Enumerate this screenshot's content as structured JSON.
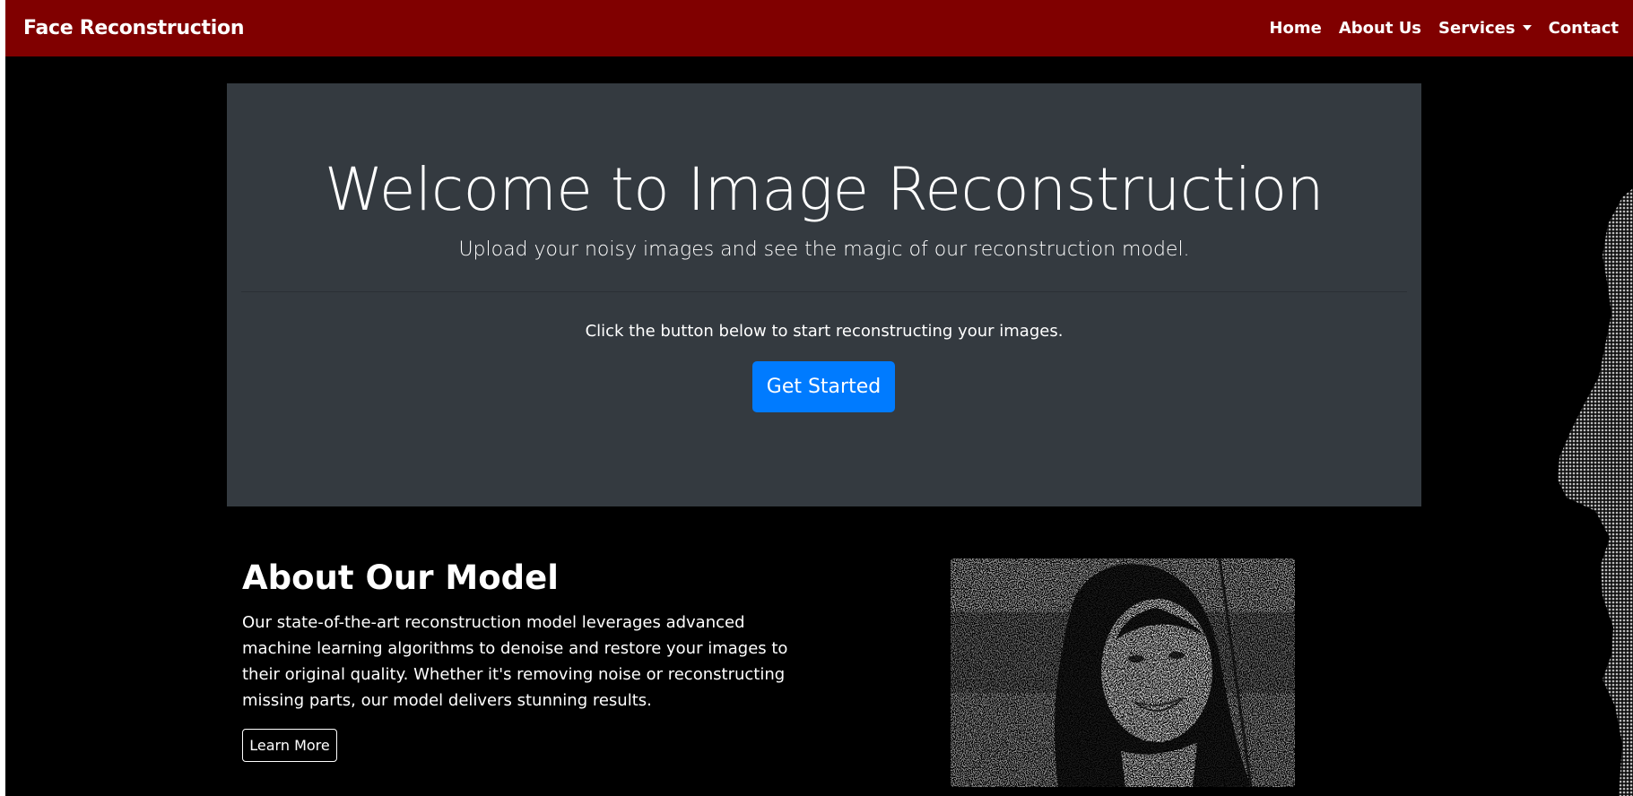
{
  "navbar": {
    "brand": "Face Reconstruction",
    "links": [
      "Home",
      "About Us",
      "Services",
      "Contact"
    ],
    "bg_color": "#800000"
  },
  "hero": {
    "title": "Welcome to Image Reconstruction",
    "subtitle": "Upload your noisy images and see the magic of our reconstruction model.",
    "cta_text": "Click the button below to start reconstructing your images.",
    "button_label": "Get Started",
    "button_color": "#007bff"
  },
  "about": {
    "title": "About Our Model",
    "text": "Our state-of-the-art reconstruction model leverages advanced machine learning algorithms to denoise and restore your images to their original quality. Whether it's removing noise or reconstructing missing parts, our model delivers stunning results.",
    "button_label": "Learn More"
  },
  "icons": {
    "dropdown": "caret-down-icon"
  }
}
